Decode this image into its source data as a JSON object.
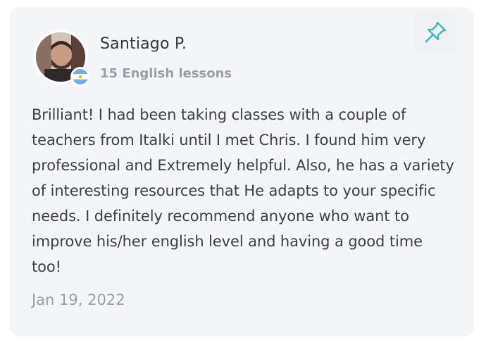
{
  "reviewer": {
    "name": "Santiago P.",
    "lessons": "15 English lessons",
    "flag_icon": "argentina-flag-icon"
  },
  "review": {
    "text": "Brilliant! I had been taking classes with a couple of teachers from Italki until I met Chris. I found him very professional and Extremely helpful. Also, he has a variety of interesting resources that He adapts to your specific needs. I definitely recommend anyone who want to improve his/her english level and having a good time too!",
    "date": "Jan 19, 2022"
  },
  "actions": {
    "pin_icon": "pushpin-icon"
  },
  "colors": {
    "card_background": "#f4f5f8",
    "accent_teal": "#3fb8c4",
    "text_primary": "#333740",
    "text_muted": "#9aa0ab",
    "flag_blue": "#74acdf"
  }
}
